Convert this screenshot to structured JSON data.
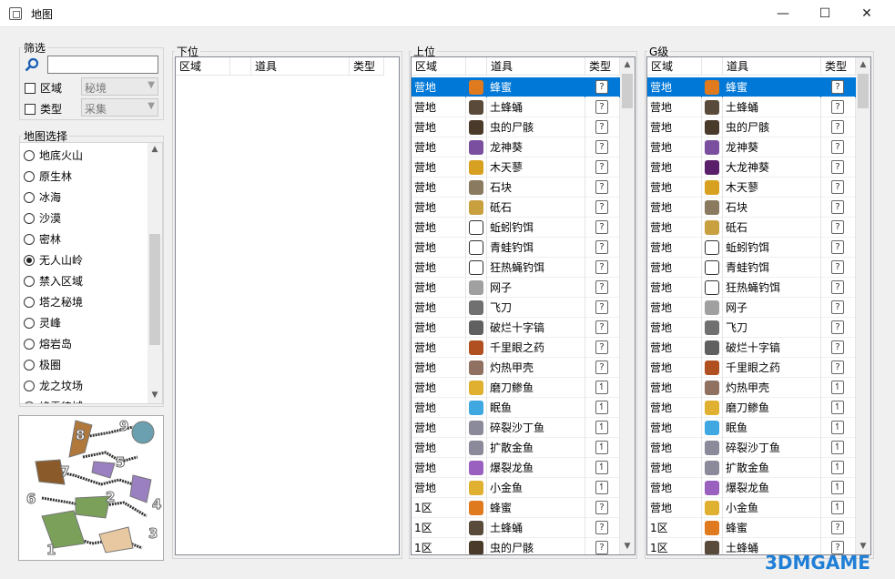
{
  "window": {
    "title": "地图",
    "min": "—",
    "max": "☐",
    "close": "✕",
    "icon": "map-icon"
  },
  "filter": {
    "legend": "筛选",
    "search_placeholder": "",
    "search_value": "",
    "area_label": "区域",
    "area_value": "秘境",
    "type_label": "类型",
    "type_value": "采集"
  },
  "map_select": {
    "legend": "地图选择",
    "items": [
      "地底火山",
      "原生林",
      "冰海",
      "沙漠",
      "密林",
      "无人山岭",
      "禁入区域",
      "塔之秘境",
      "灵峰",
      "熔岩岛",
      "极圈",
      "龙之坟场",
      "峰雪律城"
    ],
    "selected": 5
  },
  "minimap_labels": [
    "1",
    "2",
    "3",
    "4",
    "5",
    "6",
    "7",
    "8",
    "9"
  ],
  "low": {
    "legend": "下位",
    "headers": [
      "区域",
      "",
      "道具",
      "类型"
    ],
    "rows": []
  },
  "high": {
    "legend": "上位",
    "headers": [
      "区域",
      "",
      "道具",
      "类型"
    ],
    "rows": [
      [
        "营地",
        "蜂蜜",
        "honey",
        "q"
      ],
      [
        "营地",
        "土蜂蛹",
        "larva",
        "q"
      ],
      [
        "营地",
        "虫的尸骸",
        "husk",
        "q"
      ],
      [
        "营地",
        "龙神葵",
        "purple",
        "q"
      ],
      [
        "营地",
        "木天蓼",
        "yellow",
        "q"
      ],
      [
        "营地",
        "石块",
        "stone",
        "q"
      ],
      [
        "营地",
        "砥石",
        "whetstone",
        "q"
      ],
      [
        "营地",
        "蚯蚓钓饵",
        "bait",
        "q"
      ],
      [
        "营地",
        "青蛙钓饵",
        "bait",
        "q"
      ],
      [
        "营地",
        "狂热蝇钓饵",
        "bait",
        "q"
      ],
      [
        "营地",
        "网子",
        "net",
        "q"
      ],
      [
        "营地",
        "飞刀",
        "knife",
        "q"
      ],
      [
        "营地",
        "破烂十字镐",
        "pickaxe",
        "q"
      ],
      [
        "营地",
        "千里眼之药",
        "potion",
        "q"
      ],
      [
        "营地",
        "灼热甲壳",
        "shell",
        "q"
      ],
      [
        "营地",
        "磨刀鲹鱼",
        "fish-yellow",
        "f"
      ],
      [
        "营地",
        "眠鱼",
        "fish-blue",
        "f"
      ],
      [
        "营地",
        "碎裂沙丁鱼",
        "fish-gray",
        "f"
      ],
      [
        "营地",
        "扩散金鱼",
        "fish-gray",
        "f"
      ],
      [
        "营地",
        "爆裂龙鱼",
        "fish-purple",
        "f"
      ],
      [
        "营地",
        "小金鱼",
        "fish-yellow",
        "f"
      ],
      [
        "1区",
        "蜂蜜",
        "honey",
        "q"
      ],
      [
        "1区",
        "土蜂蛹",
        "larva",
        "q"
      ],
      [
        "1区",
        "虫的尸骸",
        "husk",
        "q"
      ]
    ],
    "selected": 0
  },
  "g": {
    "legend": "G级",
    "headers": [
      "区域",
      "",
      "道具",
      "类型"
    ],
    "rows": [
      [
        "营地",
        "蜂蜜",
        "honey",
        "q"
      ],
      [
        "营地",
        "土蜂蛹",
        "larva",
        "q"
      ],
      [
        "营地",
        "虫的尸骸",
        "husk",
        "q"
      ],
      [
        "营地",
        "龙神葵",
        "purple",
        "q"
      ],
      [
        "营地",
        "大龙神葵",
        "darkpurple",
        "q"
      ],
      [
        "营地",
        "木天蓼",
        "yellow",
        "q"
      ],
      [
        "营地",
        "石块",
        "stone",
        "q"
      ],
      [
        "营地",
        "砥石",
        "whetstone",
        "q"
      ],
      [
        "营地",
        "蚯蚓钓饵",
        "bait",
        "q"
      ],
      [
        "营地",
        "青蛙钓饵",
        "bait",
        "q"
      ],
      [
        "营地",
        "狂热蝇钓饵",
        "bait",
        "q"
      ],
      [
        "营地",
        "网子",
        "net",
        "q"
      ],
      [
        "营地",
        "飞刀",
        "knife",
        "q"
      ],
      [
        "营地",
        "破烂十字镐",
        "pickaxe",
        "q"
      ],
      [
        "营地",
        "千里眼之药",
        "potion",
        "q"
      ],
      [
        "营地",
        "灼热甲壳",
        "shell",
        "f"
      ],
      [
        "营地",
        "磨刀鲹鱼",
        "fish-yellow",
        "f"
      ],
      [
        "营地",
        "眠鱼",
        "fish-blue",
        "f"
      ],
      [
        "营地",
        "碎裂沙丁鱼",
        "fish-gray",
        "f"
      ],
      [
        "营地",
        "扩散金鱼",
        "fish-gray",
        "f"
      ],
      [
        "营地",
        "爆裂龙鱼",
        "fish-purple",
        "f"
      ],
      [
        "营地",
        "小金鱼",
        "fish-yellow",
        "f"
      ],
      [
        "1区",
        "蜂蜜",
        "honey",
        "q"
      ],
      [
        "1区",
        "土蜂蛹",
        "larva",
        "q"
      ]
    ],
    "selected": 0
  },
  "icon_colors": {
    "honey": "#e07a1f",
    "larva": "#5a4a3a",
    "husk": "#4a3a2a",
    "purple": "#7a4fa0",
    "darkpurple": "#5a1f6a",
    "yellow": "#d8a020",
    "stone": "#8a7a60",
    "whetstone": "#c8a040",
    "bait": "#ffffff",
    "net": "#a0a0a0",
    "knife": "#707070",
    "pickaxe": "#606060",
    "potion": "#b05020",
    "shell": "#907060",
    "fish-yellow": "#e0b030",
    "fish-blue": "#40a8e0",
    "fish-gray": "#8a8a9a",
    "fish-purple": "#9a60c0"
  },
  "watermark": "3DMGAME"
}
